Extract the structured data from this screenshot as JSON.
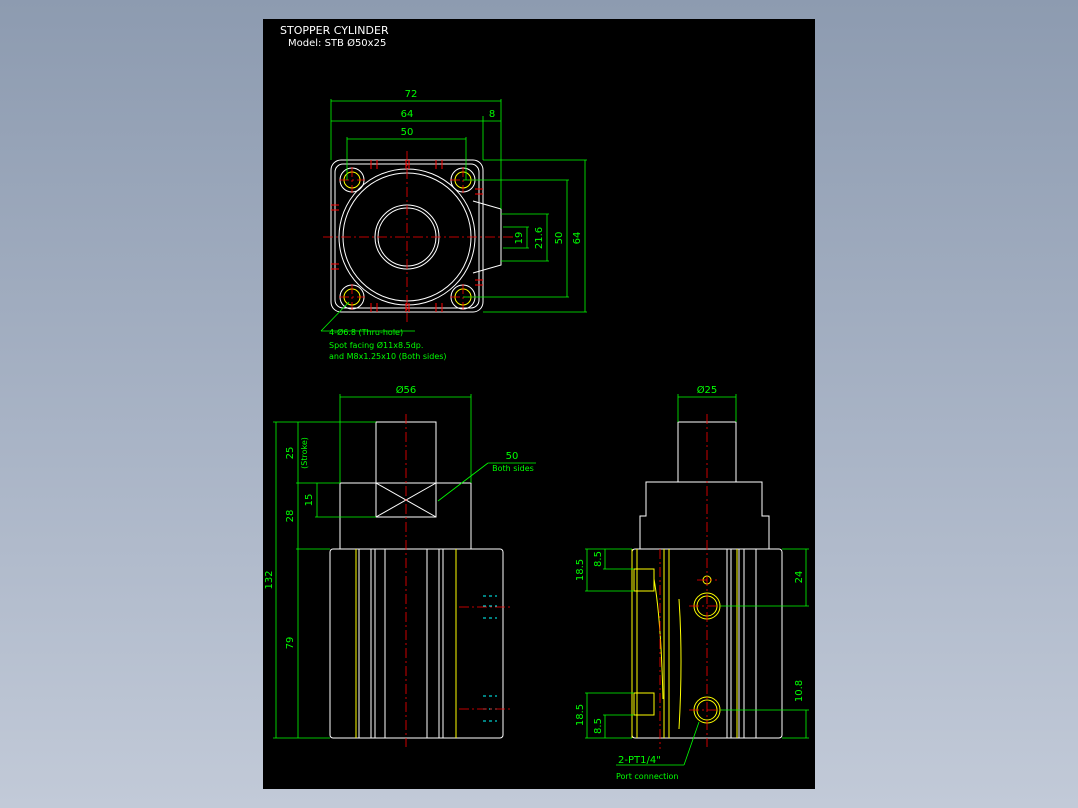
{
  "title": {
    "name": "STOPPER CYLINDER",
    "model": "Model: STB Ø50x25"
  },
  "top_view": {
    "dims": {
      "overall_width": "72",
      "body_width": "64",
      "port_boss": "8",
      "bore_pitch": "50",
      "boss_19": "19",
      "boss_21_6": "21.6",
      "pitch_50": "50",
      "height_64": "64"
    },
    "note": {
      "line1": "4-Ø6.8  (Thru-hole)",
      "line2": "Spot facing Ø11x8.5dp.",
      "line3": "and M8x1.25x10 (Both sides)"
    }
  },
  "front_view": {
    "dims": {
      "rod_dia": "Ø56",
      "stroke": "25",
      "stroke_label": "(Stroke)",
      "dim_15": "15",
      "dim_28": "28",
      "dim_132": "132",
      "dim_79": "79",
      "flats": "50",
      "flats_note": "Both sides"
    }
  },
  "side_view": {
    "dims": {
      "rod_dia": "Ø25",
      "top_18_5": "18.5",
      "top_8_5": "8.5",
      "port_24": "24",
      "bot_18_5": "18.5",
      "bot_8_5": "8.5",
      "port_10_8": "10.8",
      "port": "2-PT1/4\"",
      "port_note": "Port connection"
    }
  },
  "colors": {
    "background": "#000000",
    "outline": "#ffffff",
    "dimension": "#00ff00",
    "centerline": "#ff0000",
    "detail": "#ffff00",
    "hidden": "#00ffff"
  }
}
